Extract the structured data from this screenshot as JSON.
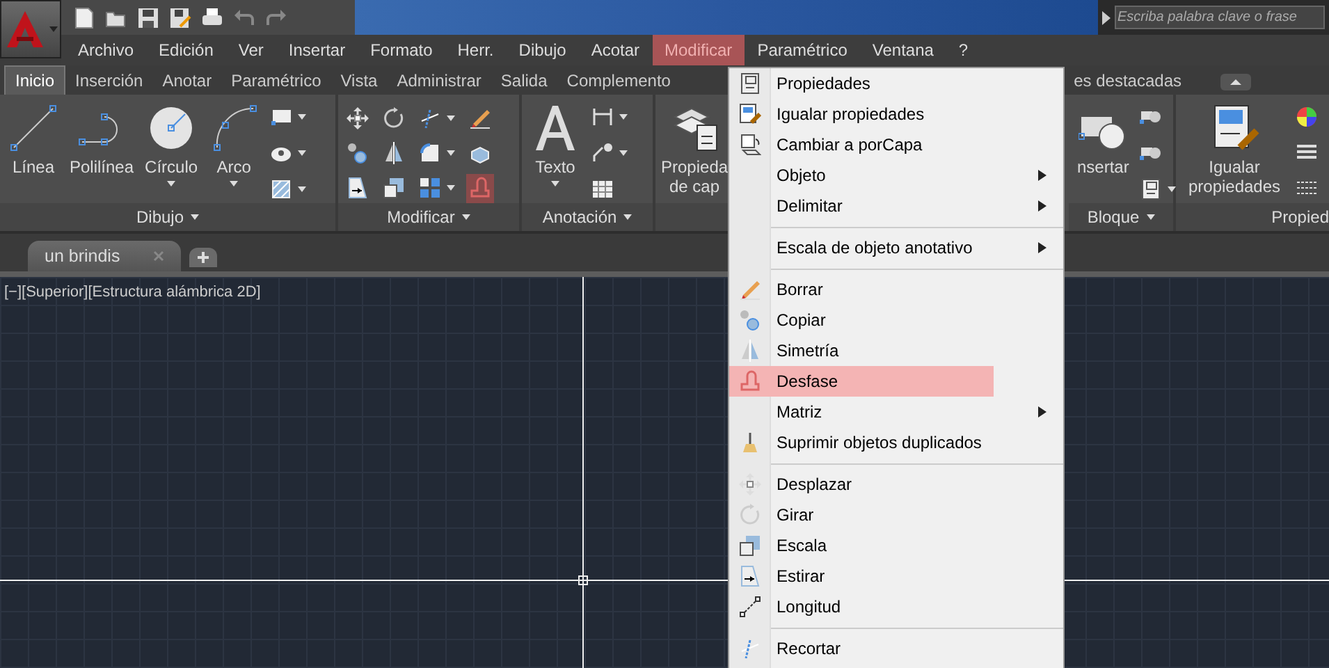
{
  "search": {
    "placeholder": "Escriba palabra clave o frase"
  },
  "menu_bar": [
    {
      "label": "Archivo",
      "selected": false
    },
    {
      "label": "Edición",
      "selected": false
    },
    {
      "label": "Ver",
      "selected": false
    },
    {
      "label": "Insertar",
      "selected": false
    },
    {
      "label": "Formato",
      "selected": false
    },
    {
      "label": "Herr.",
      "selected": false
    },
    {
      "label": "Dibujo",
      "selected": false
    },
    {
      "label": "Acotar",
      "selected": false
    },
    {
      "label": "Modificar",
      "selected": true
    },
    {
      "label": "Paramétrico",
      "selected": false
    },
    {
      "label": "Ventana",
      "selected": false
    },
    {
      "label": "?",
      "selected": false
    }
  ],
  "ribbon_tabs": [
    {
      "label": "Inicio",
      "selected": true
    },
    {
      "label": "Inserción",
      "selected": false
    },
    {
      "label": "Anotar",
      "selected": false
    },
    {
      "label": "Paramétrico",
      "selected": false
    },
    {
      "label": "Vista",
      "selected": false
    },
    {
      "label": "Administrar",
      "selected": false
    },
    {
      "label": "Salida",
      "selected": false
    },
    {
      "label": "Complemento",
      "selected": false
    }
  ],
  "ribbon_tabs_right": [
    {
      "label": "es destacadas",
      "selected": false
    }
  ],
  "draw_panel": {
    "title": "Dibujo",
    "tools": [
      {
        "label": "Línea"
      },
      {
        "label": "Polilínea"
      },
      {
        "label": "Círculo"
      },
      {
        "label": "Arco"
      }
    ]
  },
  "modify_panel": {
    "title": "Modificar",
    "tools": [
      {
        "highlighted": false
      },
      {
        "highlighted": false
      },
      {
        "highlighted": false
      },
      {
        "highlighted": false
      },
      {
        "highlighted": false
      },
      {
        "highlighted": false
      },
      {
        "highlighted": false
      },
      {
        "highlighted": false
      },
      {
        "highlighted": false
      },
      {
        "highlighted": false
      },
      {
        "highlighted": false
      },
      {
        "highlighted": true
      }
    ]
  },
  "annotation_panel": {
    "title": "Anotación",
    "tool": "Texto"
  },
  "layers_panel": {
    "tool": "Propieda de cap"
  },
  "block_panel": {
    "title": "Bloque",
    "tool": "nsertar"
  },
  "properties_panel": {
    "title": "Propied",
    "tool": "Igualar propiedades"
  },
  "document_tabs": [
    {
      "label": "un brindis",
      "selected": true
    }
  ],
  "viewport": {
    "label": "[−][Superior][Estructura alámbrica 2D]"
  },
  "context_menu": {
    "groups": [
      [
        {
          "label": "Propiedades",
          "submenu": false,
          "highlighted": false
        },
        {
          "label": "Igualar propiedades",
          "submenu": false,
          "highlighted": false
        },
        {
          "label": "Cambiar a porCapa",
          "submenu": false,
          "highlighted": false
        },
        {
          "label": "Objeto",
          "submenu": true,
          "highlighted": false
        },
        {
          "label": "Delimitar",
          "submenu": true,
          "highlighted": false
        }
      ],
      [
        {
          "label": "Escala de objeto anotativo",
          "submenu": true,
          "highlighted": false
        }
      ],
      [
        {
          "label": "Borrar",
          "submenu": false,
          "highlighted": false
        },
        {
          "label": "Copiar",
          "submenu": false,
          "highlighted": false
        },
        {
          "label": "Simetría",
          "submenu": false,
          "highlighted": false
        },
        {
          "label": "Desfase",
          "submenu": false,
          "highlighted": true
        },
        {
          "label": "Matriz",
          "submenu": true,
          "highlighted": false
        },
        {
          "label": "Suprimir objetos duplicados",
          "submenu": false,
          "highlighted": false
        }
      ],
      [
        {
          "label": "Desplazar",
          "submenu": false,
          "highlighted": false
        },
        {
          "label": "Girar",
          "submenu": false,
          "highlighted": false
        },
        {
          "label": "Escala",
          "submenu": false,
          "highlighted": false
        },
        {
          "label": "Estirar",
          "submenu": false,
          "highlighted": false
        },
        {
          "label": "Longitud",
          "submenu": false,
          "highlighted": false
        }
      ],
      [
        {
          "label": "Recortar",
          "submenu": false,
          "highlighted": false
        }
      ]
    ]
  }
}
